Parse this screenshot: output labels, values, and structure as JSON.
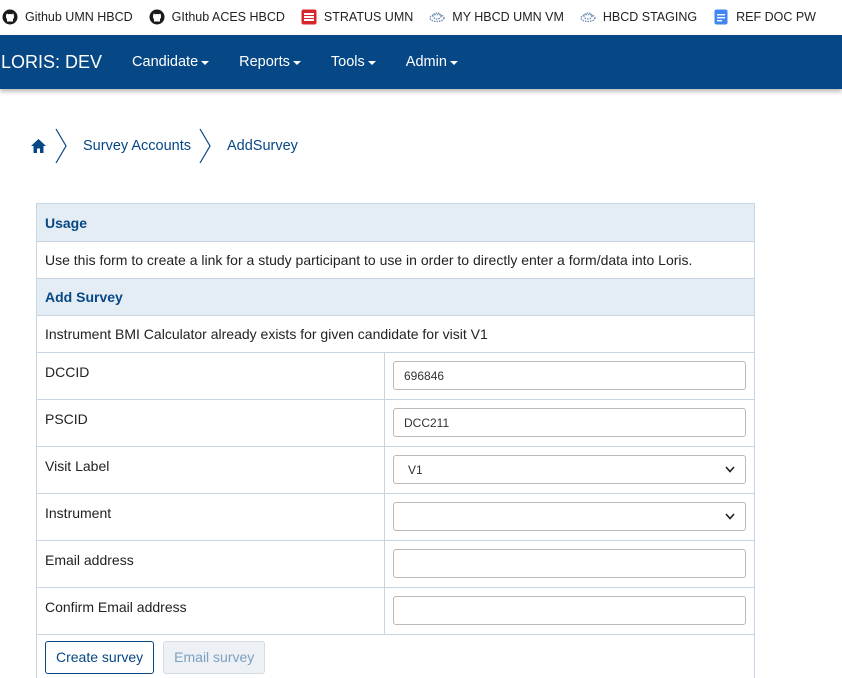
{
  "bookmarks": [
    {
      "label": "Github UMN HBCD",
      "icon": "github-icon"
    },
    {
      "label": "GIthub ACES HBCD",
      "icon": "github-icon"
    },
    {
      "label": "STRATUS UMN",
      "icon": "stratus-icon"
    },
    {
      "label": "MY HBCD UMN VM",
      "icon": "cloud-icon"
    },
    {
      "label": "HBCD STAGING",
      "icon": "cloud-icon"
    },
    {
      "label": "REF DOC PW",
      "icon": "document-icon"
    }
  ],
  "navbar": {
    "brand": "LORIS: DEV",
    "menus": [
      "Candidate",
      "Reports",
      "Tools",
      "Admin"
    ],
    "background": "#064785"
  },
  "breadcrumb": {
    "home_icon": "home-icon",
    "items": [
      "Survey Accounts",
      "AddSurvey"
    ]
  },
  "form": {
    "usage_heading": "Usage",
    "usage_text": "Use this form to create a link for a study participant to use in order to directly enter a form/data into Loris.",
    "add_heading": "Add Survey",
    "error_text": "Instrument BMI Calculator already exists for given candidate for visit V1",
    "fields": {
      "dccid": {
        "label": "DCCID",
        "value": "696846"
      },
      "pscid": {
        "label": "PSCID",
        "value": "DCC211"
      },
      "visit": {
        "label": "Visit Label",
        "value": "V1"
      },
      "instrument": {
        "label": "Instrument",
        "value": ""
      },
      "email": {
        "label": "Email address",
        "value": ""
      },
      "confirm_email": {
        "label": "Confirm Email address",
        "value": ""
      }
    },
    "buttons": {
      "create": "Create survey",
      "email": "Email survey"
    }
  }
}
